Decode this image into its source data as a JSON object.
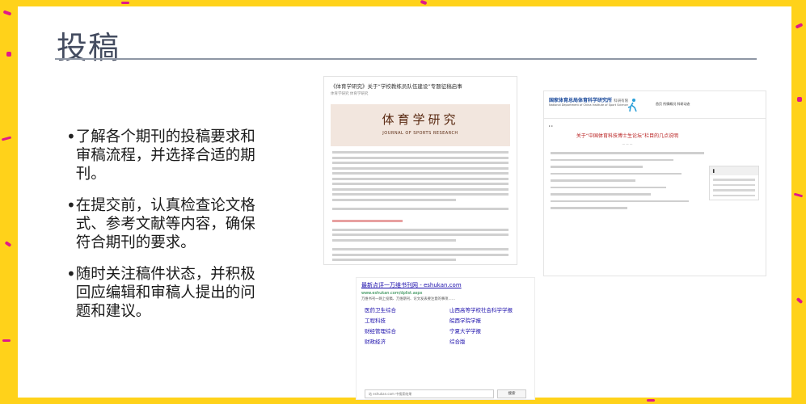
{
  "slide": {
    "title": "投稿",
    "bullets": [
      "了解各个期刊的投稿要求和审稿流程，并选择合适的期刊。",
      "在提交前，认真检查论文格式、参考文献等内容，确保符合期刊的要求。",
      "随时关注稿件状态，并积极回应编辑和审稿人提出的问题和建议。"
    ],
    "bullet_glyph": "•"
  },
  "shot1": {
    "headline": "《体育学研究》关于“学校教练员队伍建设”专题征稿启事",
    "meta": "体育学研究  体育学研究",
    "banner_cn": "体育学研究",
    "banner_en": "JOURNAL OF SPORTS RESEARCH"
  },
  "shot2": {
    "brand": "国家体育总局体育科学研究所",
    "brand_suffix": "科研有限",
    "brand_en": "National Department of China Institute of Sport Science",
    "nav": "首页  所情概况  科研动态",
    "headline": "关于“中国体育科技博士生论坛”栏目的几点说明"
  },
  "shot3": {
    "title": "最新点评一万维书刊网 - eshukan.com",
    "url": "www.eshukan.com/dplist.aspx",
    "desc": "万维书刊一网上投稿、万维期刊、论文发表要注意的事项……",
    "links": [
      {
        "name": "医药卫生综合",
        "sub": ""
      },
      {
        "name": "山西高等学校社会科学学报",
        "sub": ""
      },
      {
        "name": "工程科技",
        "sub": ""
      },
      {
        "name": "皖西学院学报",
        "sub": ""
      },
      {
        "name": "财经管理综合",
        "sub": ""
      },
      {
        "name": "宁夏大学学报",
        "sub": ""
      },
      {
        "name": "财政经济",
        "sub": ""
      },
      {
        "name": "综合版",
        "sub": ""
      }
    ],
    "search_placeholder": "站 eshukan.com 中搜索结果",
    "search_button": "搜索"
  },
  "colors": {
    "border": "#ffd21a",
    "confetti": "#e0198a",
    "title": "#444c60",
    "banner_bg": "#f2e6de",
    "link": "#1a0dab",
    "headline_red": "#b71c1c"
  }
}
